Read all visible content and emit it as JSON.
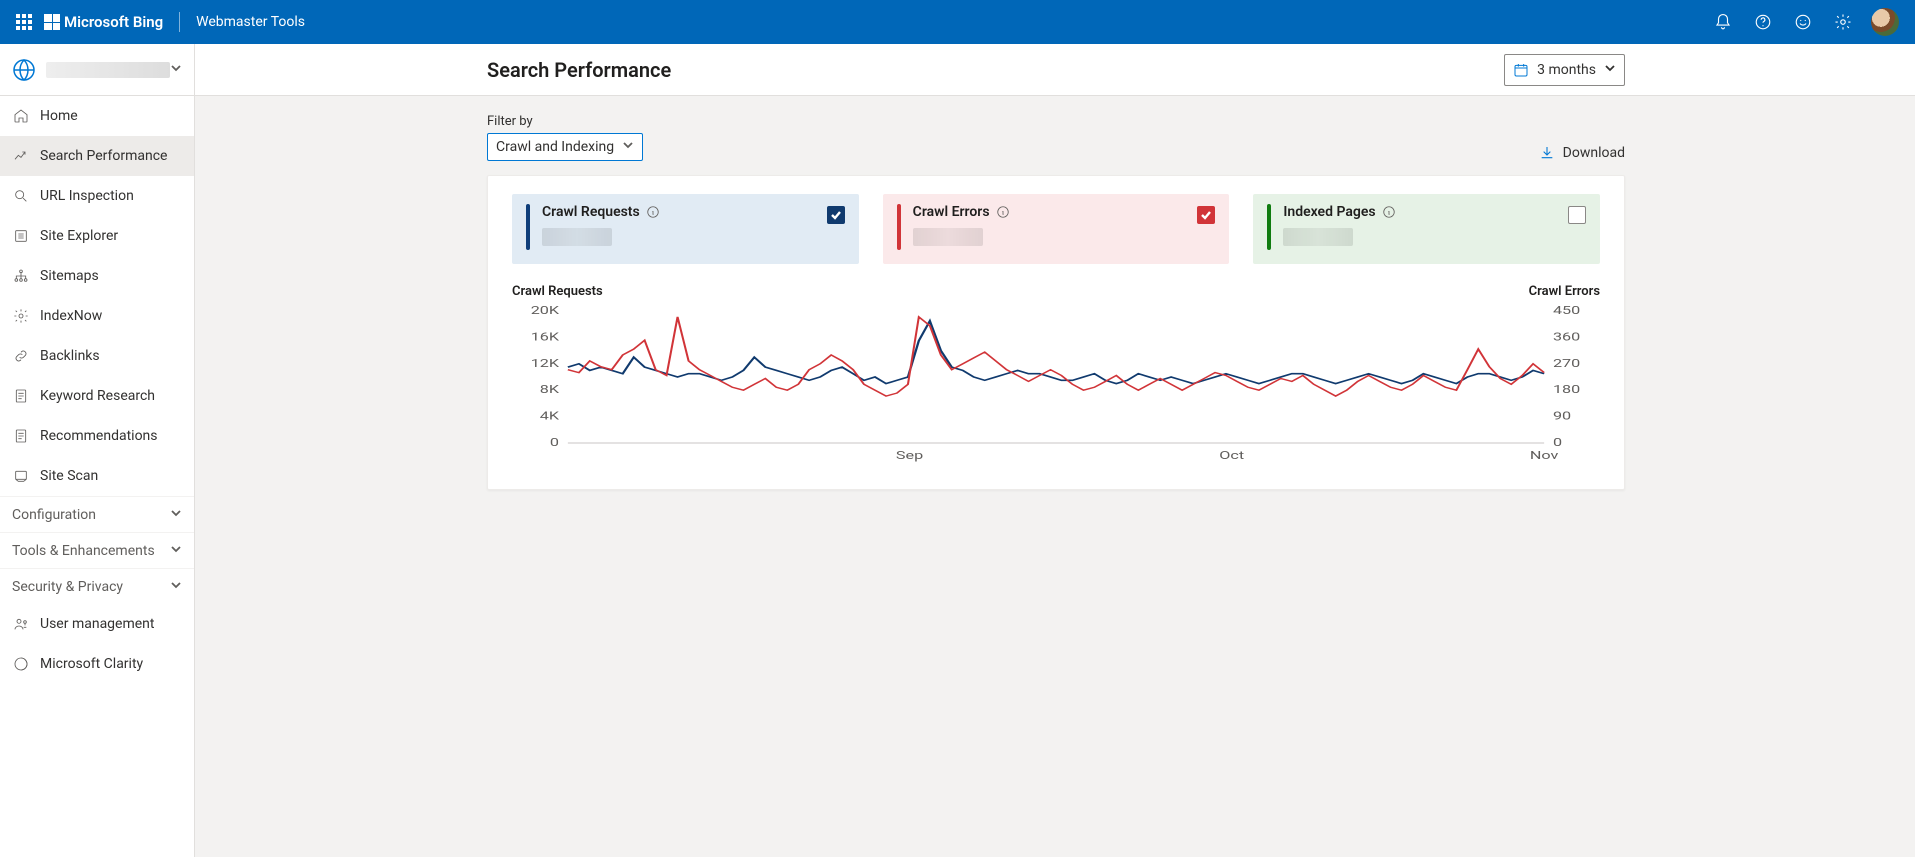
{
  "header": {
    "brand_primary": "Microsoft Bing",
    "brand_secondary": "Webmaster Tools"
  },
  "sidebar": {
    "items": [
      {
        "label": "Home",
        "icon": "home"
      },
      {
        "label": "Search Performance",
        "icon": "trend",
        "selected": true
      },
      {
        "label": "URL Inspection",
        "icon": "search"
      },
      {
        "label": "Site Explorer",
        "icon": "list"
      },
      {
        "label": "Sitemaps",
        "icon": "sitemap"
      },
      {
        "label": "IndexNow",
        "icon": "gear"
      },
      {
        "label": "Backlinks",
        "icon": "link"
      },
      {
        "label": "Keyword Research",
        "icon": "doc"
      },
      {
        "label": "Recommendations",
        "icon": "clipboard"
      },
      {
        "label": "Site Scan",
        "icon": "scan"
      }
    ],
    "groups": [
      {
        "label": "Configuration"
      },
      {
        "label": "Tools & Enhancements"
      },
      {
        "label": "Security & Privacy"
      }
    ],
    "footer_items": [
      {
        "label": "User management",
        "icon": "user"
      },
      {
        "label": "Microsoft Clarity",
        "icon": "clarity"
      }
    ]
  },
  "page": {
    "title": "Search Performance",
    "date_range": "3 months",
    "filter_label": "Filter by",
    "filter_value": "Crawl and Indexing",
    "download_label": "Download"
  },
  "metrics": [
    {
      "title": "Crawl Requests",
      "tone": "blue",
      "checked": true
    },
    {
      "title": "Crawl Errors",
      "tone": "red",
      "checked": true
    },
    {
      "title": "Indexed Pages",
      "tone": "green",
      "checked": false
    }
  ],
  "chart_data": {
    "type": "line",
    "left_title": "Crawl Requests",
    "right_title": "Crawl Errors",
    "ylabel_left": "",
    "ylabel_right": "",
    "y_left_ticks": [
      0,
      "4K",
      "8K",
      "12K",
      "16K",
      "20K"
    ],
    "y_right_ticks": [
      0,
      90,
      180,
      270,
      360,
      450
    ],
    "ylim_left": [
      0,
      20000
    ],
    "ylim_right": [
      0,
      450
    ],
    "x_ticks": [
      "Sep",
      "Oct",
      "Nov"
    ],
    "x": [
      0,
      1,
      2,
      3,
      4,
      5,
      6,
      7,
      8,
      9,
      10,
      11,
      12,
      13,
      14,
      15,
      16,
      17,
      18,
      19,
      20,
      21,
      22,
      23,
      24,
      25,
      26,
      27,
      28,
      29,
      30,
      31,
      32,
      33,
      34,
      35,
      36,
      37,
      38,
      39,
      40,
      41,
      42,
      43,
      44,
      45,
      46,
      47,
      48,
      49,
      50,
      51,
      52,
      53,
      54,
      55,
      56,
      57,
      58,
      59,
      60,
      61,
      62,
      63,
      64,
      65,
      66,
      67,
      68,
      69,
      70,
      71,
      72,
      73,
      74,
      75,
      76,
      77,
      78,
      79,
      80,
      81,
      82,
      83,
      84,
      85,
      86,
      87,
      88,
      89
    ],
    "series": [
      {
        "name": "Crawl Requests",
        "axis": "left",
        "color": "#103a6e",
        "values": [
          11500,
          12000,
          11000,
          11500,
          11000,
          10500,
          13000,
          11500,
          11000,
          10500,
          10000,
          10500,
          10500,
          10000,
          9500,
          10000,
          11000,
          13000,
          11500,
          11000,
          10500,
          10000,
          9500,
          10000,
          11000,
          11500,
          10500,
          9500,
          10000,
          9000,
          9500,
          10000,
          15500,
          18500,
          14000,
          11500,
          11000,
          10000,
          9500,
          10000,
          10500,
          11000,
          10500,
          10500,
          10000,
          9500,
          9500,
          10000,
          10500,
          9500,
          9000,
          9500,
          10500,
          10000,
          9500,
          10000,
          9500,
          9000,
          9500,
          10000,
          10500,
          10000,
          9500,
          9000,
          9500,
          10000,
          10500,
          10500,
          10000,
          9500,
          9000,
          9500,
          10000,
          10500,
          10000,
          9500,
          9000,
          9500,
          10500,
          10000,
          9500,
          9000,
          10000,
          10500,
          10500,
          10000,
          9500,
          10000,
          11000,
          10500
        ]
      },
      {
        "name": "Crawl Errors",
        "axis": "right",
        "color": "#d13438",
        "values": [
          250,
          240,
          280,
          260,
          250,
          300,
          320,
          350,
          250,
          230,
          430,
          280,
          250,
          230,
          210,
          190,
          180,
          200,
          220,
          190,
          180,
          200,
          250,
          270,
          300,
          280,
          250,
          200,
          180,
          160,
          170,
          200,
          430,
          400,
          300,
          250,
          270,
          290,
          310,
          280,
          250,
          230,
          210,
          230,
          250,
          230,
          200,
          180,
          190,
          210,
          230,
          200,
          180,
          200,
          220,
          200,
          180,
          200,
          220,
          240,
          230,
          210,
          190,
          180,
          200,
          220,
          210,
          230,
          200,
          180,
          160,
          180,
          210,
          230,
          210,
          190,
          180,
          200,
          230,
          210,
          190,
          180,
          250,
          320,
          260,
          220,
          200,
          230,
          270,
          240
        ]
      }
    ]
  }
}
